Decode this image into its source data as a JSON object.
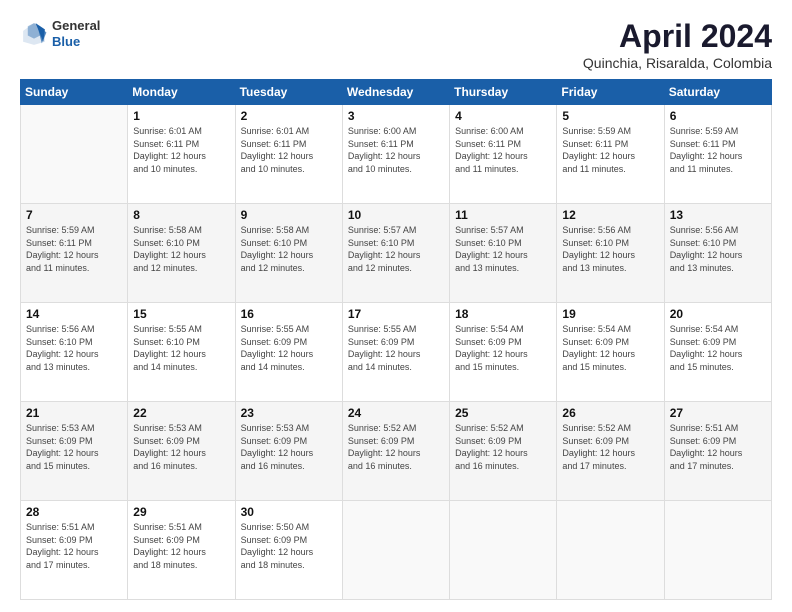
{
  "header": {
    "logo": {
      "general": "General",
      "blue": "Blue"
    },
    "title": "April 2024",
    "location": "Quinchia, Risaralda, Colombia"
  },
  "days_of_week": [
    "Sunday",
    "Monday",
    "Tuesday",
    "Wednesday",
    "Thursday",
    "Friday",
    "Saturday"
  ],
  "weeks": [
    [
      {
        "day": "",
        "info": ""
      },
      {
        "day": "1",
        "info": "Sunrise: 6:01 AM\nSunset: 6:11 PM\nDaylight: 12 hours\nand 10 minutes."
      },
      {
        "day": "2",
        "info": "Sunrise: 6:01 AM\nSunset: 6:11 PM\nDaylight: 12 hours\nand 10 minutes."
      },
      {
        "day": "3",
        "info": "Sunrise: 6:00 AM\nSunset: 6:11 PM\nDaylight: 12 hours\nand 10 minutes."
      },
      {
        "day": "4",
        "info": "Sunrise: 6:00 AM\nSunset: 6:11 PM\nDaylight: 12 hours\nand 11 minutes."
      },
      {
        "day": "5",
        "info": "Sunrise: 5:59 AM\nSunset: 6:11 PM\nDaylight: 12 hours\nand 11 minutes."
      },
      {
        "day": "6",
        "info": "Sunrise: 5:59 AM\nSunset: 6:11 PM\nDaylight: 12 hours\nand 11 minutes."
      }
    ],
    [
      {
        "day": "7",
        "info": "Sunrise: 5:59 AM\nSunset: 6:11 PM\nDaylight: 12 hours\nand 11 minutes."
      },
      {
        "day": "8",
        "info": "Sunrise: 5:58 AM\nSunset: 6:10 PM\nDaylight: 12 hours\nand 12 minutes."
      },
      {
        "day": "9",
        "info": "Sunrise: 5:58 AM\nSunset: 6:10 PM\nDaylight: 12 hours\nand 12 minutes."
      },
      {
        "day": "10",
        "info": "Sunrise: 5:57 AM\nSunset: 6:10 PM\nDaylight: 12 hours\nand 12 minutes."
      },
      {
        "day": "11",
        "info": "Sunrise: 5:57 AM\nSunset: 6:10 PM\nDaylight: 12 hours\nand 13 minutes."
      },
      {
        "day": "12",
        "info": "Sunrise: 5:56 AM\nSunset: 6:10 PM\nDaylight: 12 hours\nand 13 minutes."
      },
      {
        "day": "13",
        "info": "Sunrise: 5:56 AM\nSunset: 6:10 PM\nDaylight: 12 hours\nand 13 minutes."
      }
    ],
    [
      {
        "day": "14",
        "info": "Sunrise: 5:56 AM\nSunset: 6:10 PM\nDaylight: 12 hours\nand 13 minutes."
      },
      {
        "day": "15",
        "info": "Sunrise: 5:55 AM\nSunset: 6:10 PM\nDaylight: 12 hours\nand 14 minutes."
      },
      {
        "day": "16",
        "info": "Sunrise: 5:55 AM\nSunset: 6:09 PM\nDaylight: 12 hours\nand 14 minutes."
      },
      {
        "day": "17",
        "info": "Sunrise: 5:55 AM\nSunset: 6:09 PM\nDaylight: 12 hours\nand 14 minutes."
      },
      {
        "day": "18",
        "info": "Sunrise: 5:54 AM\nSunset: 6:09 PM\nDaylight: 12 hours\nand 15 minutes."
      },
      {
        "day": "19",
        "info": "Sunrise: 5:54 AM\nSunset: 6:09 PM\nDaylight: 12 hours\nand 15 minutes."
      },
      {
        "day": "20",
        "info": "Sunrise: 5:54 AM\nSunset: 6:09 PM\nDaylight: 12 hours\nand 15 minutes."
      }
    ],
    [
      {
        "day": "21",
        "info": "Sunrise: 5:53 AM\nSunset: 6:09 PM\nDaylight: 12 hours\nand 15 minutes."
      },
      {
        "day": "22",
        "info": "Sunrise: 5:53 AM\nSunset: 6:09 PM\nDaylight: 12 hours\nand 16 minutes."
      },
      {
        "day": "23",
        "info": "Sunrise: 5:53 AM\nSunset: 6:09 PM\nDaylight: 12 hours\nand 16 minutes."
      },
      {
        "day": "24",
        "info": "Sunrise: 5:52 AM\nSunset: 6:09 PM\nDaylight: 12 hours\nand 16 minutes."
      },
      {
        "day": "25",
        "info": "Sunrise: 5:52 AM\nSunset: 6:09 PM\nDaylight: 12 hours\nand 16 minutes."
      },
      {
        "day": "26",
        "info": "Sunrise: 5:52 AM\nSunset: 6:09 PM\nDaylight: 12 hours\nand 17 minutes."
      },
      {
        "day": "27",
        "info": "Sunrise: 5:51 AM\nSunset: 6:09 PM\nDaylight: 12 hours\nand 17 minutes."
      }
    ],
    [
      {
        "day": "28",
        "info": "Sunrise: 5:51 AM\nSunset: 6:09 PM\nDaylight: 12 hours\nand 17 minutes."
      },
      {
        "day": "29",
        "info": "Sunrise: 5:51 AM\nSunset: 6:09 PM\nDaylight: 12 hours\nand 18 minutes."
      },
      {
        "day": "30",
        "info": "Sunrise: 5:50 AM\nSunset: 6:09 PM\nDaylight: 12 hours\nand 18 minutes."
      },
      {
        "day": "",
        "info": ""
      },
      {
        "day": "",
        "info": ""
      },
      {
        "day": "",
        "info": ""
      },
      {
        "day": "",
        "info": ""
      }
    ]
  ]
}
